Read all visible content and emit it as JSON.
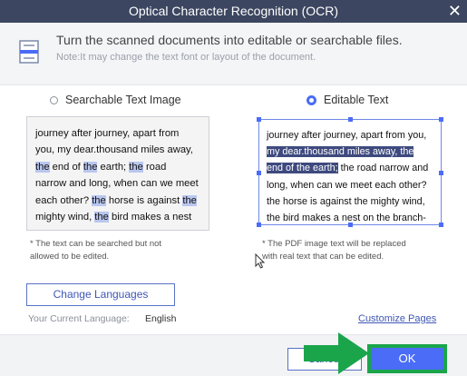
{
  "window": {
    "title": "Optical Character Recognition (OCR)",
    "close_glyph": "✕"
  },
  "header": {
    "icon": "document-icon",
    "main": "Turn the scanned documents into editable or searchable files.",
    "note": "Note:It may change the text font or layout of the document."
  },
  "options": {
    "searchable": {
      "label": "Searchable Text Image",
      "selected": false
    },
    "editable": {
      "label": "Editable Text",
      "selected": true
    }
  },
  "preview_left": {
    "lines": [
      "journey after journey, apart from",
      "you, my dear.thousand miles away,",
      "the end of the earth; the road",
      "narrow and long, when can we meet",
      "each other? the horse is against the",
      "mighty wind, the bird makes a nest"
    ]
  },
  "preview_right": {
    "lines": [
      "journey after journey, apart from you,",
      "my dear.thousand miles away, the",
      "end of the earth; the road narrow and",
      "long, when can we meet each other?",
      "the horse is against the mighty wind,",
      "the bird makes a nest on the branch-"
    ]
  },
  "notes": {
    "left": [
      "* The text can be searched but not",
      "allowed to be edited."
    ],
    "right": [
      "* The PDF image text will be replaced",
      "with real text that can be edited."
    ]
  },
  "language": {
    "button_label": "Change Languages",
    "current_label": "Your Current Language:",
    "current_value": "English"
  },
  "customize_label": "Customize Pages",
  "footer": {
    "cancel_label": "Cancel",
    "ok_label": "OK"
  },
  "colors": {
    "titlebar": "#3c4660",
    "accent": "#4a6cf7",
    "highlight_box": "#1aa54b",
    "arrow": "#1aa54b"
  }
}
